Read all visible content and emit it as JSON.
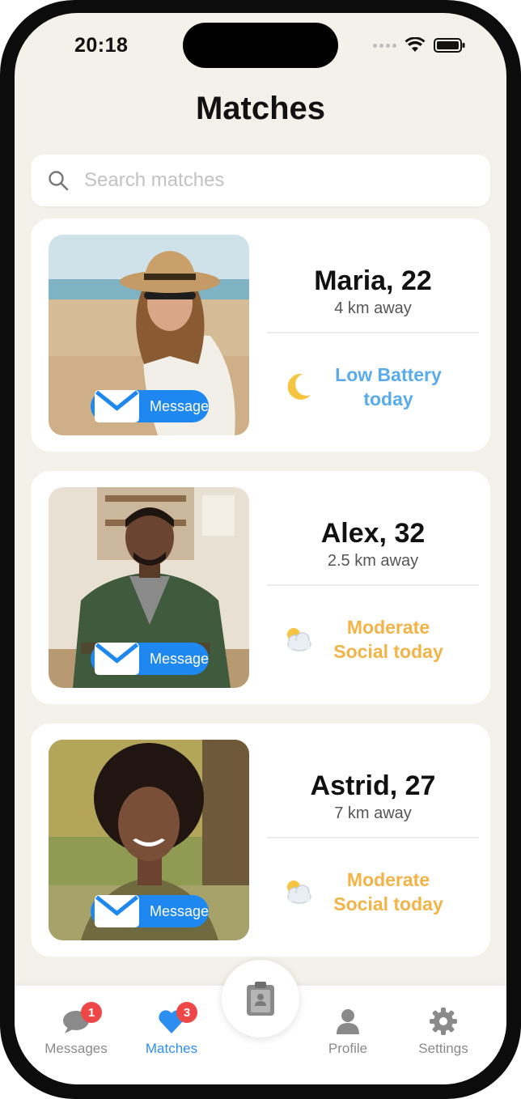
{
  "status": {
    "time": "20:18"
  },
  "header": {
    "title": "Matches"
  },
  "search": {
    "placeholder": "Search matches"
  },
  "matches": [
    {
      "name": "Maria, 22",
      "distance": "4 km away",
      "mood_line1": "Low Battery",
      "mood_line2": "today",
      "mood_icon": "crescent-moon-icon",
      "mood_color": "#5aabea",
      "message_label": "Message"
    },
    {
      "name": "Alex, 32",
      "distance": "2.5 km away",
      "mood_line1": "Moderate",
      "mood_line2": "Social today",
      "mood_icon": "sun-behind-cloud-icon",
      "mood_color": "#f2b347",
      "message_label": "Message"
    },
    {
      "name": "Astrid, 27",
      "distance": "7 km away",
      "mood_line1": "Moderate",
      "mood_line2": "Social today",
      "mood_icon": "sun-behind-cloud-icon",
      "mood_color": "#f2b347",
      "message_label": "Message"
    }
  ],
  "tabbar": {
    "items": [
      {
        "label": "Messages",
        "badge": "1",
        "icon": "chat-bubble-icon"
      },
      {
        "label": "Matches",
        "badge": "3",
        "icon": "heart-icon",
        "active": true
      },
      {
        "label": "Profile",
        "icon": "person-icon"
      },
      {
        "label": "Settings",
        "icon": "gear-icon"
      }
    ],
    "center_icon": "clipboard-icon"
  },
  "colors": {
    "accent": "#1e88f0",
    "active_tab": "#2c8ef0",
    "badge": "#ee4748",
    "background": "#f4f1ea"
  }
}
